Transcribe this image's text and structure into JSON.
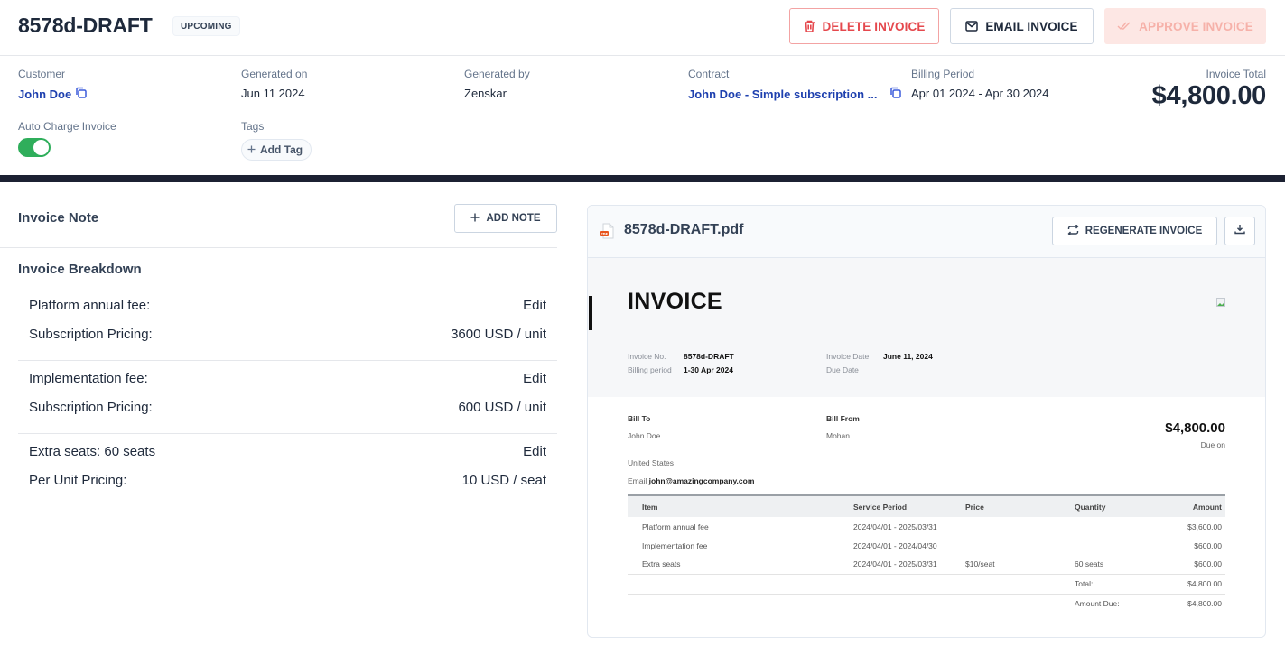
{
  "header": {
    "title": "8578d-DRAFT",
    "status": "UPCOMING",
    "buttons": {
      "delete": "DELETE INVOICE",
      "email": "EMAIL INVOICE",
      "approve": "APPROVE INVOICE"
    }
  },
  "meta": {
    "customer_label": "Customer",
    "customer_value": "John Doe",
    "generated_on_label": "Generated on",
    "generated_on_value": "Jun 11 2024",
    "generated_by_label": "Generated by",
    "generated_by_value": "Zenskar",
    "contract_label": "Contract",
    "contract_value": "John Doe - Simple subscription ...",
    "billing_period_label": "Billing Period",
    "billing_period_value": "Apr 01 2024 - Apr 30 2024",
    "invoice_total_label": "Invoice Total",
    "invoice_total_value": "$4,800.00",
    "auto_charge_label": "Auto Charge Invoice",
    "auto_charge_on": true,
    "tags_label": "Tags",
    "add_tag_label": "Add Tag"
  },
  "left_panel": {
    "invoice_note_title": "Invoice Note",
    "add_note_label": "ADD NOTE",
    "breakdown_title": "Invoice Breakdown",
    "breakdown": [
      {
        "name": "Platform annual fee:",
        "action": "Edit",
        "pricing_label": "Subscription Pricing:",
        "pricing_value": "3600 USD / unit"
      },
      {
        "name": "Implementation fee:",
        "action": "Edit",
        "pricing_label": "Subscription Pricing:",
        "pricing_value": "600 USD / unit"
      },
      {
        "name": "Extra seats: 60 seats",
        "action": "Edit",
        "pricing_label": "Per Unit Pricing:",
        "pricing_value": "10 USD / seat"
      }
    ]
  },
  "preview": {
    "file_name": "8578d-DRAFT.pdf",
    "regenerate_label": "REGENERATE INVOICE",
    "document": {
      "heading": "INVOICE",
      "invoice_no_label": "Invoice No.",
      "invoice_no": "8578d-DRAFT",
      "billing_period_label": "Billing period",
      "billing_period": "1-30 Apr 2024",
      "invoice_date_label": "Invoice Date",
      "invoice_date": "June 11, 2024",
      "due_date_label": "Due Date",
      "bill_to_label": "Bill To",
      "bill_to_name": "John Doe",
      "bill_to_country": "United States",
      "email_label": "Email",
      "email": "john@amazingcompany.com",
      "bill_from_label": "Bill From",
      "bill_from_name": "Mohan",
      "amount": "$4,800.00",
      "due_on_label": "Due on",
      "table": {
        "headers": [
          "Item",
          "Service Period",
          "Price",
          "Quantity",
          "Amount"
        ],
        "rows": [
          [
            "Platform annual fee",
            "2024/04/01 - 2025/03/31",
            "",
            "",
            "$3,600.00"
          ],
          [
            "Implementation fee",
            "2024/04/01 - 2024/04/30",
            "",
            "",
            "$600.00"
          ],
          [
            "Extra seats",
            "2024/04/01 - 2025/03/31",
            "$10/seat",
            "60 seats",
            "$600.00"
          ]
        ],
        "total_label": "Total:",
        "total_value": "$4,800.00",
        "amount_due_label": "Amount Due:",
        "amount_due_value": "$4,800.00"
      }
    }
  },
  "colors": {
    "danger": "#e5484d",
    "link": "#1e40af",
    "toggle_on": "#2fae5b",
    "approve_disabled_bg": "#fde7e4",
    "dark_band": "#1c2132"
  }
}
